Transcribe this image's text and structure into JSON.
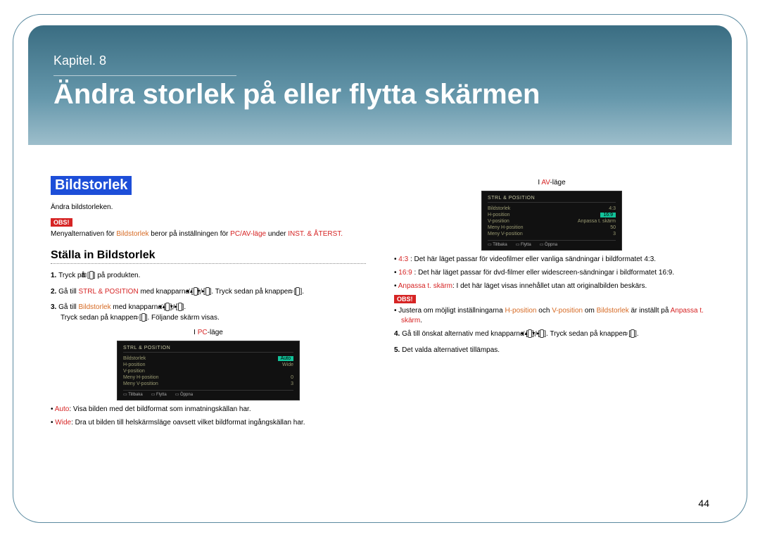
{
  "header": {
    "chapter_label": "Kapitel. 8",
    "chapter_title": "Ändra storlek på eller flytta skärmen"
  },
  "section": {
    "tag": "Bildstorlek",
    "intro": "Ändra bildstorleken.",
    "obs_label": "OBS!",
    "note_pre": "Menyalternativen för ",
    "note_hl1": "Bildstorlek",
    "note_mid": " beror på inställningen för ",
    "note_hl2": "PC/AV-läge",
    "note_mid2": " under ",
    "note_hl3": "INST. & ÅTERST.",
    "subhead": "Ställa in Bildstorlek"
  },
  "steps_left": {
    "s1_pre": "Tryck på [",
    "s1_icon": "▥",
    "s1_post": "] på produkten.",
    "s2_pre": "Gå till ",
    "s2_hl": "STRL & POSITION",
    "s2_mid": " med knapparna [",
    "s2_btn1": "◂/▴",
    "s2_sep": "], [",
    "s2_btn2": "▾/▸",
    "s2_post": "]. Tryck sedan på knappen [",
    "s2_icon": "▭",
    "s2_end": "].",
    "s3_pre": "Gå till ",
    "s3_hl": "Bildstorlek",
    "s3_mid": " med knapparna [",
    "s3_btn1": "◂/▴",
    "s3_sep": "], [",
    "s3_btn2": "▾/▸",
    "s3_end": "].",
    "s3_line2_pre": "Tryck sedan på knappen [",
    "s3_line2_icon": "▭",
    "s3_line2_post": "]. Följande skärm visas."
  },
  "caption_pc_pre": "I ",
  "caption_pc_hl": "PC",
  "caption_pc_post": "-läge",
  "osd_pc": {
    "title": "STRL & POSITION",
    "rows": [
      {
        "label": "Bildstorlek",
        "value": "Auto",
        "hi": true
      },
      {
        "label": "H-position",
        "value": "Wide"
      },
      {
        "label": "V-position",
        "value": ""
      },
      {
        "label": "Meny H-position",
        "value": "0"
      },
      {
        "label": "Meny V-position",
        "value": "3"
      }
    ],
    "foot": [
      "Tillbaka",
      "Flytta",
      "Öppna"
    ]
  },
  "bullets_pc": {
    "b1_hl": "Auto",
    "b1_txt": ": Visa bilden med det bildformat som inmatningskällan har.",
    "b2_hl": "Wide",
    "b2_txt": ": Dra ut bilden till helskärmsläge oavsett vilket bildformat ingångskällan har."
  },
  "caption_av_pre": "I ",
  "caption_av_hl": "AV",
  "caption_av_post": "-läge",
  "osd_av": {
    "title": "STRL & POSITION",
    "rows": [
      {
        "label": "Bildstorlek",
        "value": "4:3"
      },
      {
        "label": "H-position",
        "value": "16:9",
        "hi": true
      },
      {
        "label": "V-position",
        "value": "Anpassa t. skärm"
      },
      {
        "label": "Meny H-position",
        "value": "50"
      },
      {
        "label": "Meny V-position",
        "value": "3"
      }
    ],
    "foot": [
      "Tillbaka",
      "Flytta",
      "Öppna"
    ]
  },
  "bullets_av": {
    "b1_hl": "4:3",
    "b1_txt": " : Det här läget passar för videofilmer eller vanliga sändningar i bildformatet 4:3.",
    "b2_hl": "16:9",
    "b2_txt": " : Det här läget passar för dvd-filmer eller widescreen-sändningar i bildformatet 16:9.",
    "b3_hl": "Anpassa t. skärm",
    "b3_txt": ": I det här läget visas innehållet utan att originalbilden beskärs."
  },
  "obs2_label": "OBS!",
  "obs2_bullet_pre": "Justera om möjligt inställningarna ",
  "obs2_hl1": "H-position",
  "obs2_mid1": " och ",
  "obs2_hl2": "V-position",
  "obs2_mid2": " om ",
  "obs2_hl3": "Bildstorlek",
  "obs2_mid3": " är inställt på ",
  "obs2_hl4": "Anpassa t. skärm",
  "obs2_end": ".",
  "step4_pre": "Gå till önskat alternativ med knapparna [",
  "step4_btn1": "◂/▴",
  "step4_sep": "], [",
  "step4_btn2": "▾/▸",
  "step4_mid": "]. Tryck sedan på knappen [",
  "step4_icon": "▭",
  "step4_end": "].",
  "step5": "Det valda alternativet tillämpas.",
  "page_number": "44"
}
